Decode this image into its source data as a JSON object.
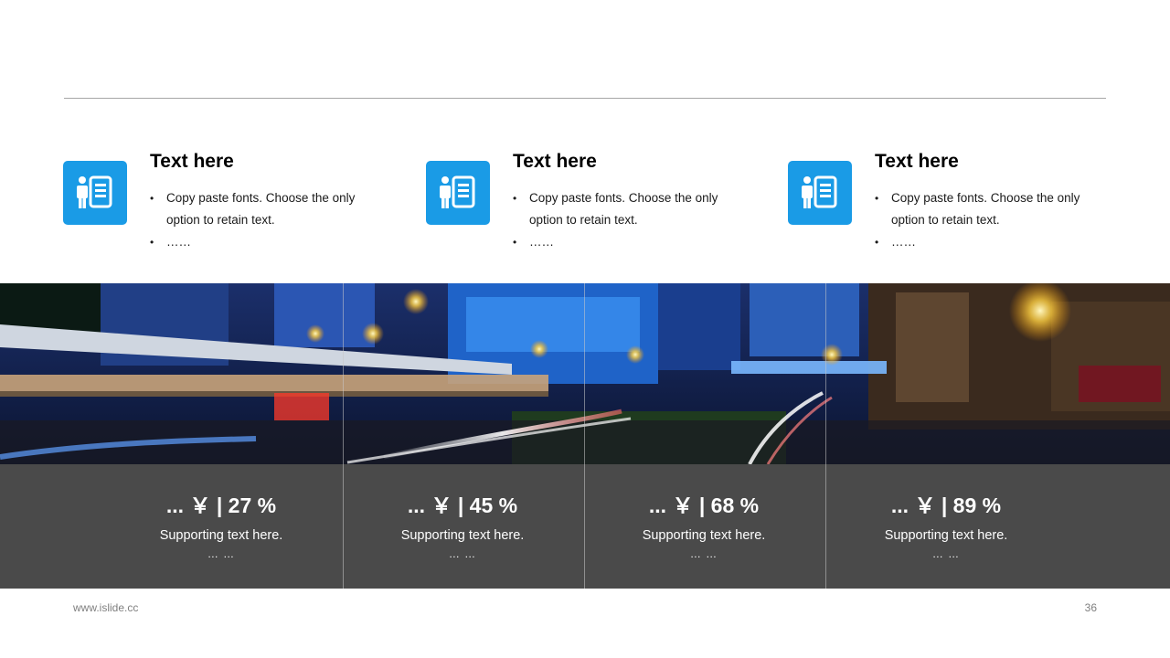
{
  "features": [
    {
      "title": "Text here",
      "bullets": [
        "Copy paste fonts. Choose the only option to retain text.",
        "……"
      ],
      "icon": "person-document-icon"
    },
    {
      "title": "Text here",
      "bullets": [
        "Copy paste fonts. Choose the only option to retain text.",
        "……"
      ],
      "icon": "person-document-icon"
    },
    {
      "title": "Text here",
      "bullets": [
        "Copy paste fonts. Choose the only option to retain text.",
        "……"
      ],
      "icon": "person-document-icon"
    }
  ],
  "stats": [
    {
      "value": "... ￥ | 27 %",
      "sub": "Supporting text here.",
      "dots": "… …"
    },
    {
      "value": "... ￥ | 45 %",
      "sub": "Supporting text here.",
      "dots": "… …"
    },
    {
      "value": "... ￥ | 68 %",
      "sub": "Supporting text here.",
      "dots": "… …"
    },
    {
      "value": "... ￥ | 89 %",
      "sub": "Supporting text here.",
      "dots": "… …"
    }
  ],
  "footer": {
    "url": "www.islide.cc",
    "page": "36"
  },
  "colors": {
    "accent": "#1a9be6",
    "stats_bg": "#4a4a4a"
  }
}
